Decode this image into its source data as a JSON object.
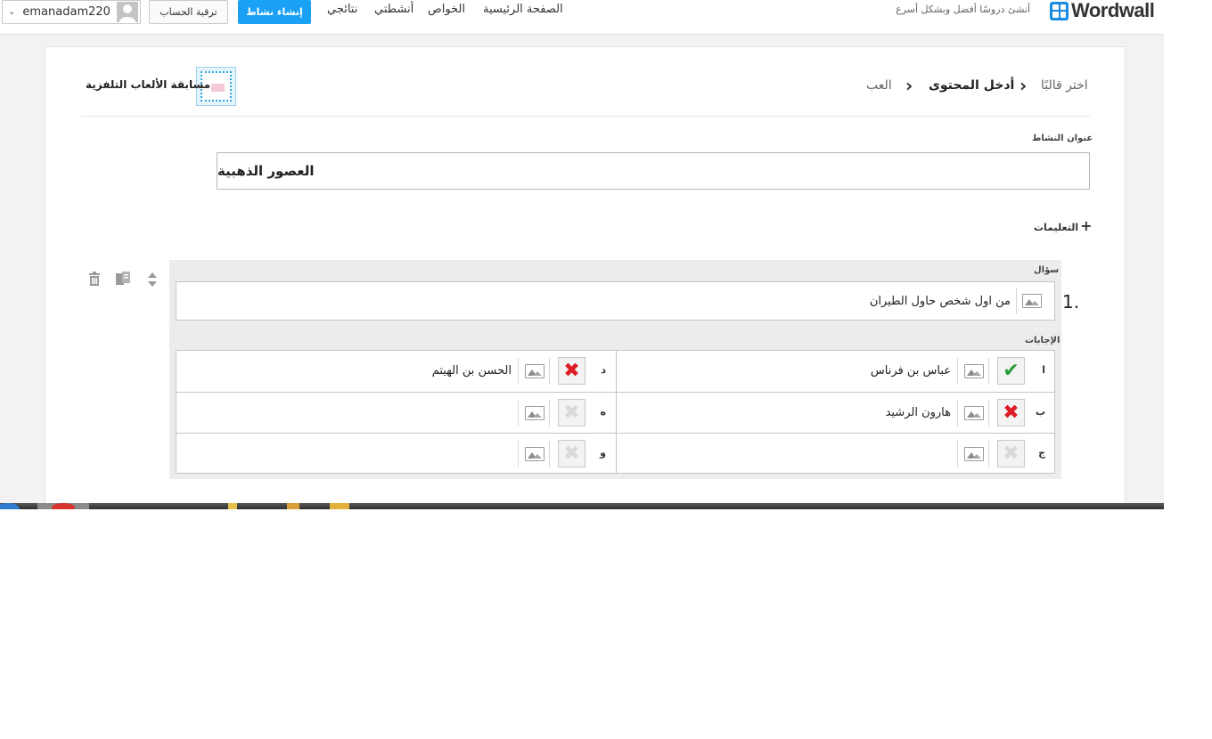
{
  "header": {
    "logo_text": "Wordwall",
    "tagline": "أنشئ دروسًا أفضل وبشكل أسرع",
    "nav": [
      "الصفحة الرئيسية",
      "الخواص",
      "أنشطتي",
      "نتائجي"
    ],
    "create_label": "إنشاء نشاط",
    "upgrade_label": "ترقية الحساب",
    "username": "emanadam220"
  },
  "breadcrumb": {
    "step1": "اختر قالبًا",
    "step2": "أدخل المحتوى",
    "step3": "العب"
  },
  "template_name": "مسابقة الألعاب التلفزية",
  "activity_title_label": "عنوان النشاط",
  "activity_title_value": "العصور الذهبية",
  "instructions_label": "التعليمات",
  "question": {
    "number": "1.",
    "label": "سؤال",
    "text": "من اول شخص حاول الطيران",
    "answers_label": "الإجابات",
    "answers": [
      {
        "letter": "ا",
        "state": "correct",
        "text": "عباس بن فرناس"
      },
      {
        "letter": "د",
        "state": "wrong",
        "text": "الحسن بن الهيتم"
      },
      {
        "letter": "ب",
        "state": "wrong",
        "text": "هارون الرشيد"
      },
      {
        "letter": "ه",
        "state": "empty",
        "text": ""
      },
      {
        "letter": "ج",
        "state": "empty",
        "text": ""
      },
      {
        "letter": "و",
        "state": "empty",
        "text": ""
      }
    ]
  },
  "icons": {
    "check": "✔",
    "cross": "✖",
    "chevron": "›",
    "user_chevron": "⌄",
    "plus": "+",
    "trash": "🗑",
    "copy": "⧉",
    "move": "⇕"
  },
  "colors": {
    "accent": "#1aa1f5",
    "correct": "#2e9e3a",
    "wrong": "#dc1d26",
    "panel": "#ececec"
  }
}
